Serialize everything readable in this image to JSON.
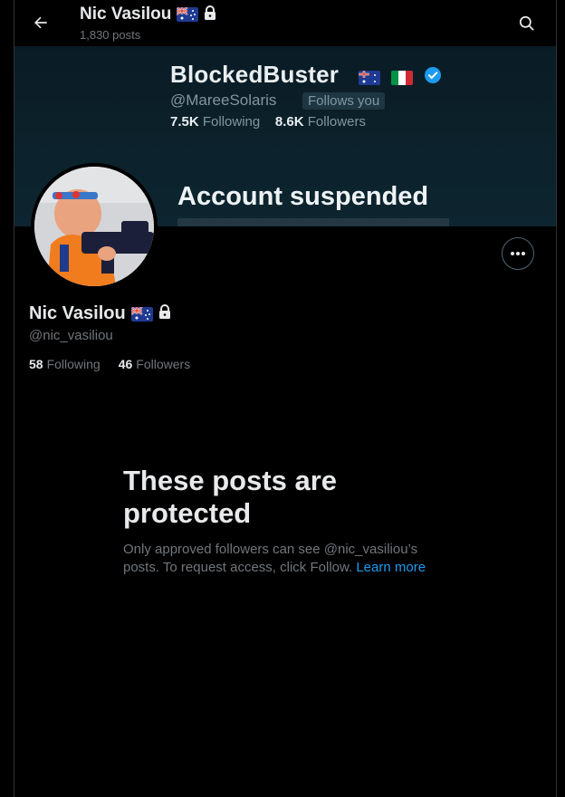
{
  "header": {
    "name": "Nic Vasilou",
    "post_count": "1,830 posts"
  },
  "banner": {
    "display_name": "BlockedBuster",
    "handle": "@MareeSolaris",
    "follows_badge": "Follows you",
    "following_count": "7.5K",
    "following_label": "Following",
    "followers_count": "8.6K",
    "followers_label": "Followers",
    "suspended_text": "Account suspended"
  },
  "profile": {
    "name": "Nic Vasilou",
    "handle": "@nic_vasiliou",
    "following_count": "58",
    "following_label": "Following",
    "followers_count": "46",
    "followers_label": "Followers"
  },
  "protected": {
    "title": "These posts are protected",
    "body": "Only approved followers can see @nic_vasiliou’s posts. To request access, click Follow.",
    "link": "Learn more"
  },
  "icons": {
    "back": "arrow-left-icon",
    "search": "search-icon",
    "more": "more-horizontal-icon",
    "lock": "lock-icon",
    "flag": "australia-flag-icon"
  },
  "colors": {
    "background": "#000000",
    "accent_link": "#1d9bf0",
    "muted_text": "#71767b",
    "primary_text": "#e7e9ea",
    "border": "#2f3336"
  }
}
